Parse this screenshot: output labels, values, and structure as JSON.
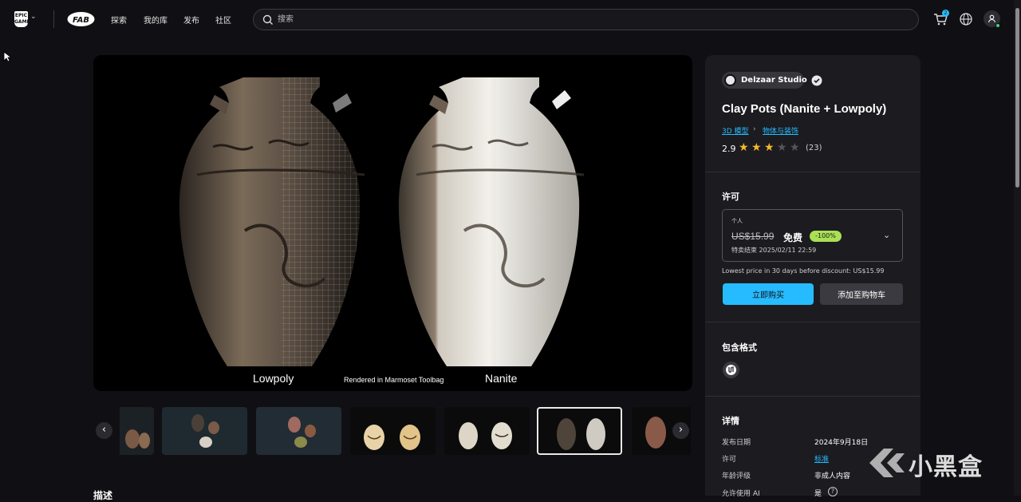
{
  "nav": {
    "logo_text": "EPIC GAMES",
    "fab_logo": "FAB",
    "items": [
      "探索",
      "我的库",
      "发布",
      "社区"
    ],
    "search_placeholder": "搜索",
    "cart_count": "2"
  },
  "hero": {
    "label_left": "Lowpoly",
    "label_center": "Rendered in Marmoset Toolbag",
    "label_right": "Nanite"
  },
  "product": {
    "seller": "Delzaar Studio",
    "title": "Clay Pots (Nanite + Lowpoly)",
    "breadcrumbs": [
      "3D 模型",
      "物体与装饰"
    ],
    "rating": "2.9",
    "stars": 3,
    "stars_total": 5,
    "rating_count": "(23)"
  },
  "license": {
    "heading": "许可",
    "tier": "个人",
    "old_price": "US$15.99",
    "new_price": "免费",
    "discount": "-100%",
    "sale_end": "特卖结束 2025/02/11 22:59",
    "lowest_note": "Lowest price in 30 days before discount: US$15.99",
    "buy_label": "立即购买",
    "add_cart_label": "添加至购物车"
  },
  "formats": {
    "heading": "包含格式",
    "items": [
      "unreal-engine-icon"
    ]
  },
  "details": {
    "heading": "详情",
    "rows": [
      {
        "label": "发布日期",
        "value": "2024年9月18日"
      },
      {
        "label": "许可",
        "value": "标准"
      },
      {
        "label": "年龄评级",
        "value": "非成人内容"
      },
      {
        "label": "允许使用 AI",
        "value": "是"
      }
    ]
  },
  "description_heading": "描述",
  "watermark": "小黑盒",
  "colors": {
    "accent": "#26bbff",
    "discount": "#a9e054",
    "star": "#f5b82e",
    "panel": "#1b1b20",
    "background": "#101014"
  }
}
